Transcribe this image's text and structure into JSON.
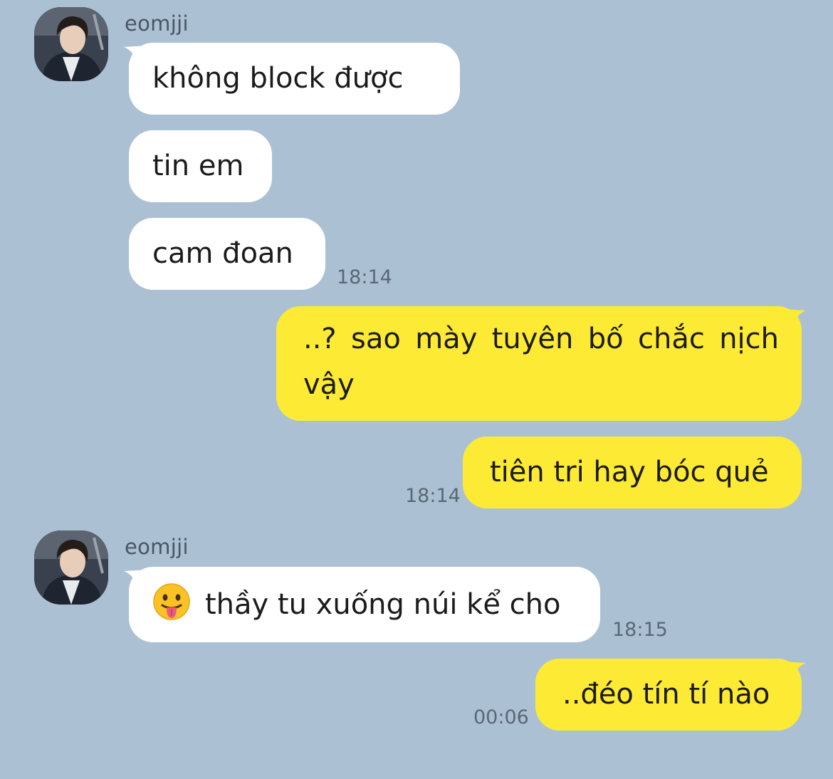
{
  "theme": {
    "background": "#abc1d3",
    "incoming_bubble": "#ffffff",
    "outgoing_bubble": "#fdea34",
    "text": "#1b1b1b",
    "meta_text": "#5b6775"
  },
  "conversation": [
    {
      "id": "group1",
      "direction": "incoming",
      "sender": "eomjji",
      "avatar_icon": "profile-photo-avatar",
      "messages": [
        "không block được",
        "tin em",
        "cam đoan"
      ],
      "time": "18:14"
    },
    {
      "id": "group2",
      "direction": "outgoing",
      "messages": [
        "..? sao mày tuyên bố chắc nịch vậy",
        "tiên tri hay bóc quẻ"
      ],
      "time": "18:14"
    },
    {
      "id": "group3",
      "direction": "incoming",
      "sender": "eomjji",
      "avatar_icon": "profile-photo-avatar",
      "messages": [
        {
          "emoji": "tongue-out-face-emoji",
          "text": "thầy tu xuống núi kể cho"
        }
      ],
      "time": "18:15"
    },
    {
      "id": "group4",
      "direction": "outgoing",
      "messages": [
        "..đéo tín tí nào"
      ],
      "time": "00:06"
    }
  ]
}
